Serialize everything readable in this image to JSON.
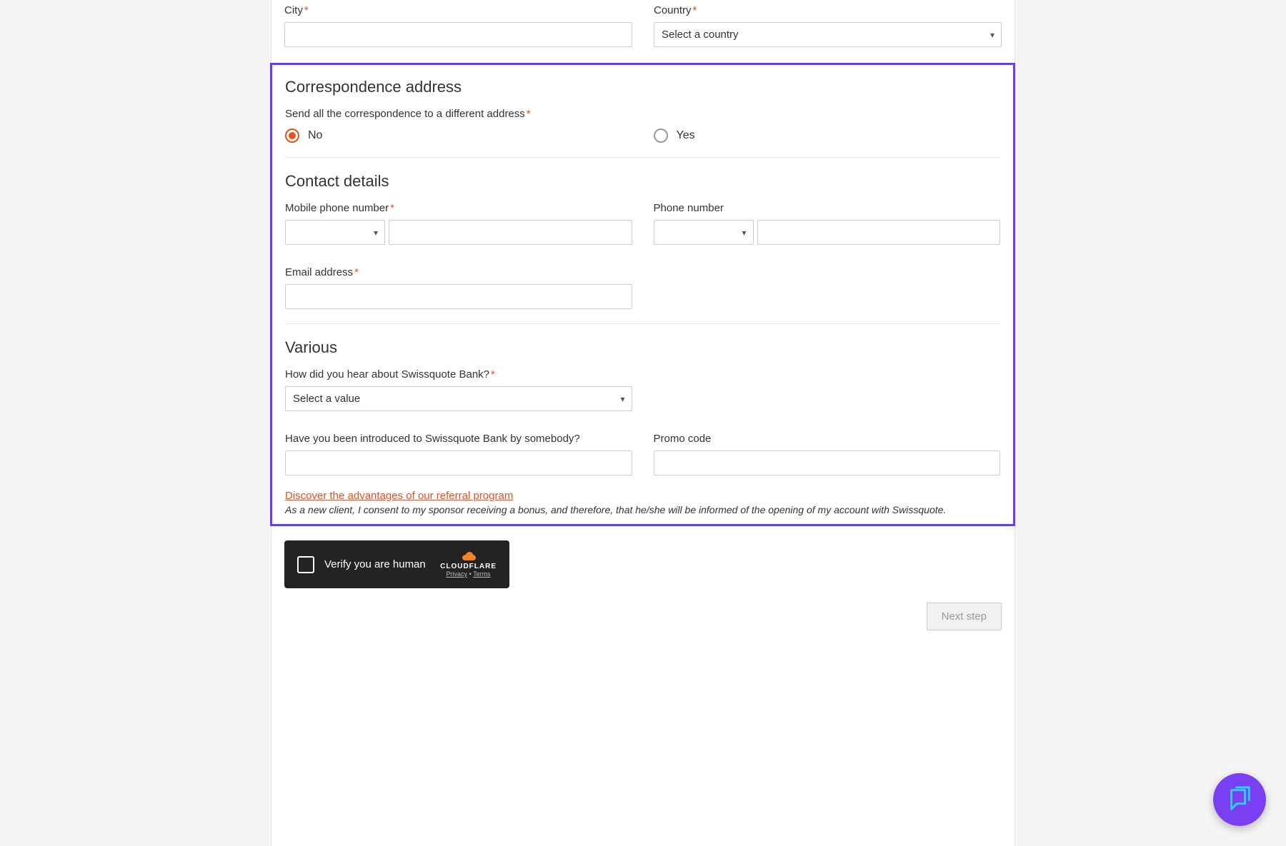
{
  "address_top": {
    "city_label": "City",
    "country_label": "Country",
    "country_placeholder": "Select a country"
  },
  "correspondence": {
    "title": "Correspondence address",
    "question": "Send all the correspondence to a different address",
    "no_label": "No",
    "yes_label": "Yes",
    "selected": "no"
  },
  "contact": {
    "title": "Contact details",
    "mobile_label": "Mobile phone number",
    "phone_label": "Phone number",
    "email_label": "Email address"
  },
  "various": {
    "title": "Various",
    "hear_label": "How did you hear about Swissquote Bank?",
    "hear_placeholder": "Select a value",
    "introduced_label": "Have you been introduced to Swissquote Bank by somebody?",
    "promo_label": "Promo code",
    "referral_link": "Discover the advantages of our referral program",
    "consent_text": "As a new client, I consent to my sponsor receiving a bonus, and therefore, that he/she will be informed of the opening of my account with Swissquote."
  },
  "captcha": {
    "verify_text": "Verify you are human",
    "brand": "CLOUDFLARE",
    "privacy": "Privacy",
    "terms": "Terms"
  },
  "footer": {
    "next_label": "Next step"
  }
}
